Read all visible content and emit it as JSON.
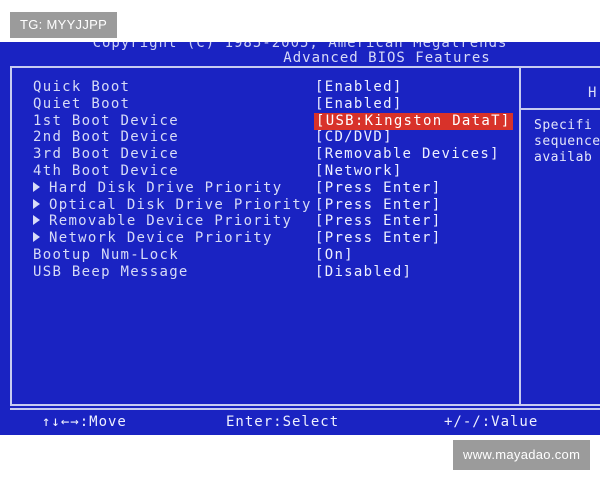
{
  "watermark_top": "TG: MYYJJPP",
  "watermark_bottom": "www.mayadao.com",
  "bios": {
    "header_line": "Copyright (C) 1985-2005, American Megatrends",
    "title": "Advanced BIOS Features",
    "help_title": "H",
    "help_text": "Specifi\nsequence\navailab",
    "items": [
      {
        "label": "Quick Boot",
        "value": "[Enabled]",
        "submenu": false,
        "selected": false
      },
      {
        "label": "Quiet Boot",
        "value": "[Enabled]",
        "submenu": false,
        "selected": false
      },
      {
        "label": "1st Boot Device",
        "value": "[USB:Kingston DataT]",
        "submenu": false,
        "selected": true
      },
      {
        "label": "2nd Boot Device",
        "value": "[CD/DVD]",
        "submenu": false,
        "selected": false
      },
      {
        "label": "3rd Boot Device",
        "value": "[Removable Devices]",
        "submenu": false,
        "selected": false
      },
      {
        "label": "4th Boot Device",
        "value": "[Network]",
        "submenu": false,
        "selected": false
      },
      {
        "label": "Hard Disk Drive Priority",
        "value": "[Press Enter]",
        "submenu": true,
        "selected": false
      },
      {
        "label": "Optical Disk Drive Priority",
        "value": "[Press Enter]",
        "submenu": true,
        "selected": false
      },
      {
        "label": "Removable Device Priority",
        "value": "[Press Enter]",
        "submenu": true,
        "selected": false
      },
      {
        "label": "Network Device Priority",
        "value": "[Press Enter]",
        "submenu": true,
        "selected": false
      },
      {
        "label": "Bootup Num-Lock",
        "value": "[On]",
        "submenu": false,
        "selected": false
      },
      {
        "label": "USB Beep Message",
        "value": "[Disabled]",
        "submenu": false,
        "selected": false
      }
    ],
    "footer": {
      "move": "↑↓←→:Move",
      "select": "Enter:Select",
      "value": "+/-/:Value"
    }
  },
  "colors": {
    "bios_bg": "#1a23c2",
    "highlight": "#d8322a",
    "text": "#d7dbf7"
  }
}
